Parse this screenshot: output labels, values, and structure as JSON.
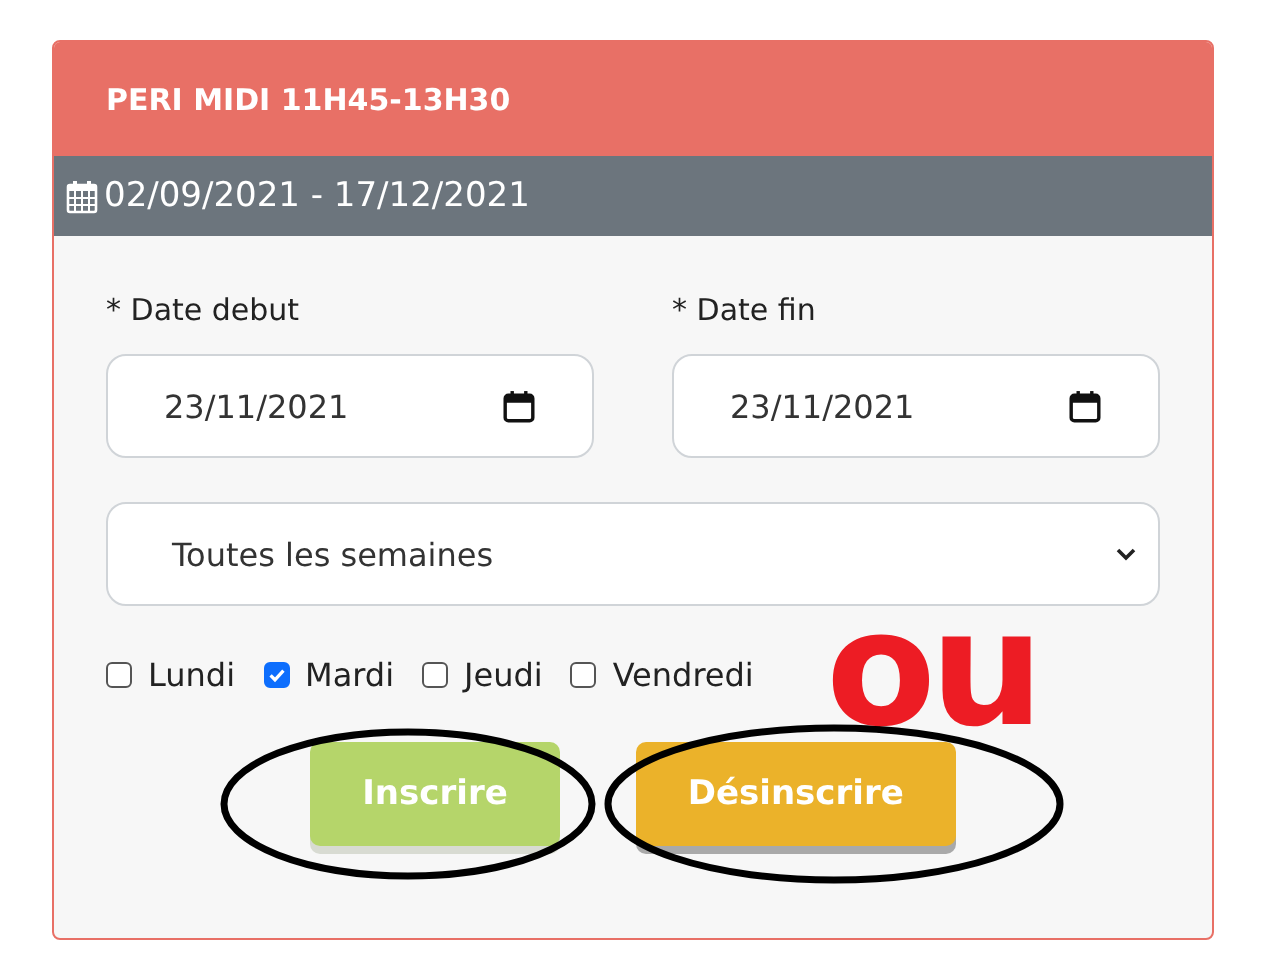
{
  "card": {
    "title": "PERI MIDI 11H45-13H30",
    "period": "02/09/2021 - 17/12/2021"
  },
  "fields": [
    {
      "label": "* Date debut",
      "value": "23/11/2021"
    },
    {
      "label": "* Date fin",
      "value": "23/11/2021"
    }
  ],
  "recurrence": {
    "value": "Toutes les semaines"
  },
  "days": [
    {
      "label": "Lundi",
      "checked": false
    },
    {
      "label": "Mardi",
      "checked": true
    },
    {
      "label": "Jeudi",
      "checked": false
    },
    {
      "label": "Vendredi",
      "checked": false
    }
  ],
  "buttons": [
    {
      "label": "Inscrire",
      "kind": "subscribe",
      "circled": true
    },
    {
      "label": "Désinscrire",
      "kind": "unsubscribe",
      "circled": true
    }
  ],
  "annotation": {
    "text": "ou"
  }
}
